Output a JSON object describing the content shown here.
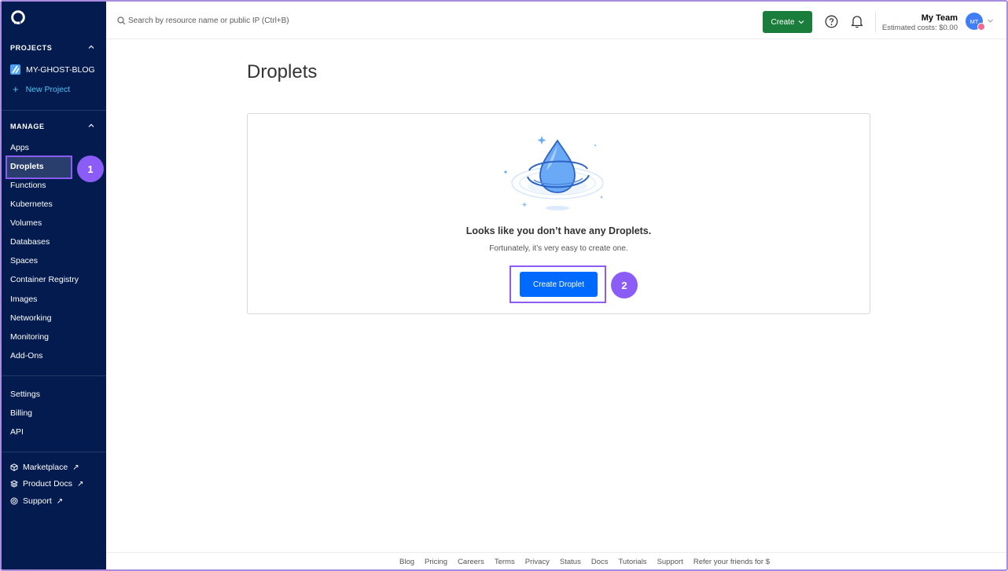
{
  "sidebar": {
    "projects_header": "PROJECTS",
    "project_name": "MY-GHOST-BLOG",
    "new_project": "New Project",
    "manage_header": "MANAGE",
    "manage_items": [
      "Apps",
      "Droplets",
      "Functions",
      "Kubernetes",
      "Volumes",
      "Databases",
      "Spaces",
      "Container Registry",
      "Images",
      "Networking",
      "Monitoring",
      "Add-Ons"
    ],
    "account_items": [
      "Settings",
      "Billing",
      "API"
    ],
    "external_items": [
      "Marketplace",
      "Product Docs",
      "Support"
    ],
    "external_arrow": "↗"
  },
  "topbar": {
    "search_placeholder": "Search by resource name or public IP (Ctrl+B)",
    "create_label": "Create",
    "team_name": "My Team",
    "estimated_costs": "Estimated costs: $0.00",
    "avatar_initials": "MT"
  },
  "main": {
    "title": "Droplets",
    "empty_title": "Looks like you don’t have any Droplets.",
    "empty_subtitle": "Fortunately, it’s very easy to create one.",
    "cta_label": "Create Droplet"
  },
  "annotations": {
    "step1": "1",
    "step2": "2"
  },
  "footer": {
    "links": [
      "Blog",
      "Pricing",
      "Careers",
      "Terms",
      "Privacy",
      "Status",
      "Docs",
      "Tutorials",
      "Support",
      "Refer your friends for $"
    ]
  },
  "colors": {
    "sidebar_bg": "#031b4e",
    "primary_blue": "#0069ff",
    "create_green": "#1b7d3c",
    "annotation_purple": "#8b5cf6",
    "new_project_cyan": "#4fc3f7"
  }
}
